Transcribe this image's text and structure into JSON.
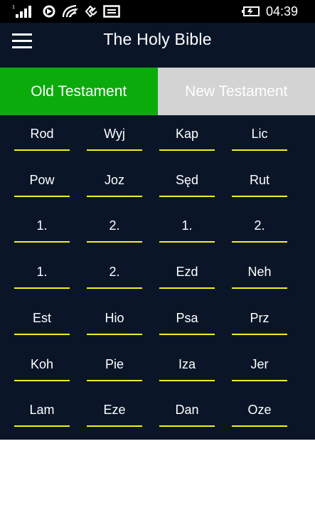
{
  "status_bar": {
    "icons": [
      "signal-icon",
      "sync-icon",
      "wifi-icon",
      "data-saver-icon",
      "message-icon",
      "battery-icon"
    ],
    "time": "04:39"
  },
  "app_bar": {
    "title": "The Holy Bible",
    "menu_icon": "hamburger-menu-icon"
  },
  "tabs": [
    {
      "label": "Old Testament",
      "selected": true,
      "color": "#0bab0b"
    },
    {
      "label": "New Testament",
      "selected": false,
      "color": "#d3d3d3"
    }
  ],
  "colors": {
    "background": "#0a1628",
    "underline": "#f5f01f",
    "text": "#ffffff"
  },
  "books": [
    [
      "Rod",
      "Wyj",
      "Kap",
      "Lic"
    ],
    [
      "Pow",
      "Joz",
      "Sęd",
      "Rut"
    ],
    [
      "1.",
      "2.",
      "1.",
      "2."
    ],
    [
      "1.",
      "2.",
      "Ezd",
      "Neh"
    ],
    [
      "Est",
      "Hio",
      "Psa",
      "Prz"
    ],
    [
      "Koh",
      "Pie",
      "Iza",
      "Jer"
    ],
    [
      "Lam",
      "Eze",
      "Dan",
      "Oze"
    ]
  ]
}
